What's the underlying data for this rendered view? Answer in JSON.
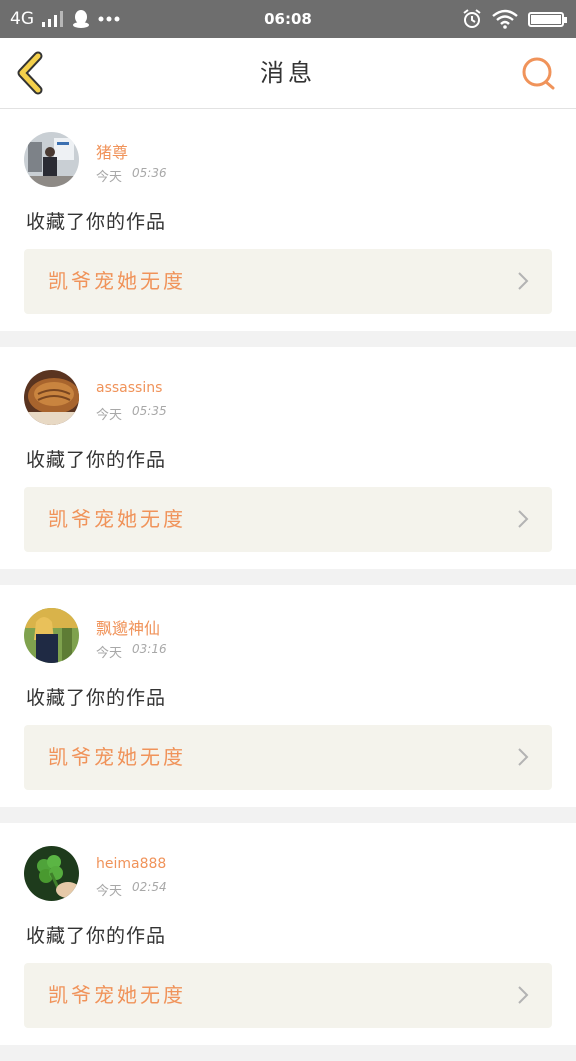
{
  "status_bar": {
    "network": "4G",
    "time": "06:08",
    "battery_level": 0.95
  },
  "navbar": {
    "title": "消息",
    "back_icon": "chevron-left-icon",
    "search_icon": "search-icon",
    "accent_color": "#f0935a",
    "back_color": "#f4d04b"
  },
  "messages": [
    {
      "user": "猪尊",
      "day": "今天",
      "time": "05:36",
      "action": "收藏了你的作品",
      "work_title": "凯爷宠她无度",
      "avatar": "person-photo"
    },
    {
      "user": "assassins",
      "day": "今天",
      "time": "05:35",
      "action": "收藏了你的作品",
      "work_title": "凯爷宠她无度",
      "avatar": "bread-photo"
    },
    {
      "user": "飘邈神仙",
      "day": "今天",
      "time": "03:16",
      "action": "收藏了你的作品",
      "work_title": "凯爷宠她无度",
      "avatar": "girl-photo"
    },
    {
      "user": "heima888",
      "day": "今天",
      "time": "02:54",
      "action": "收藏了你的作品",
      "work_title": "凯爷宠她无度",
      "avatar": "clover-photo"
    }
  ]
}
